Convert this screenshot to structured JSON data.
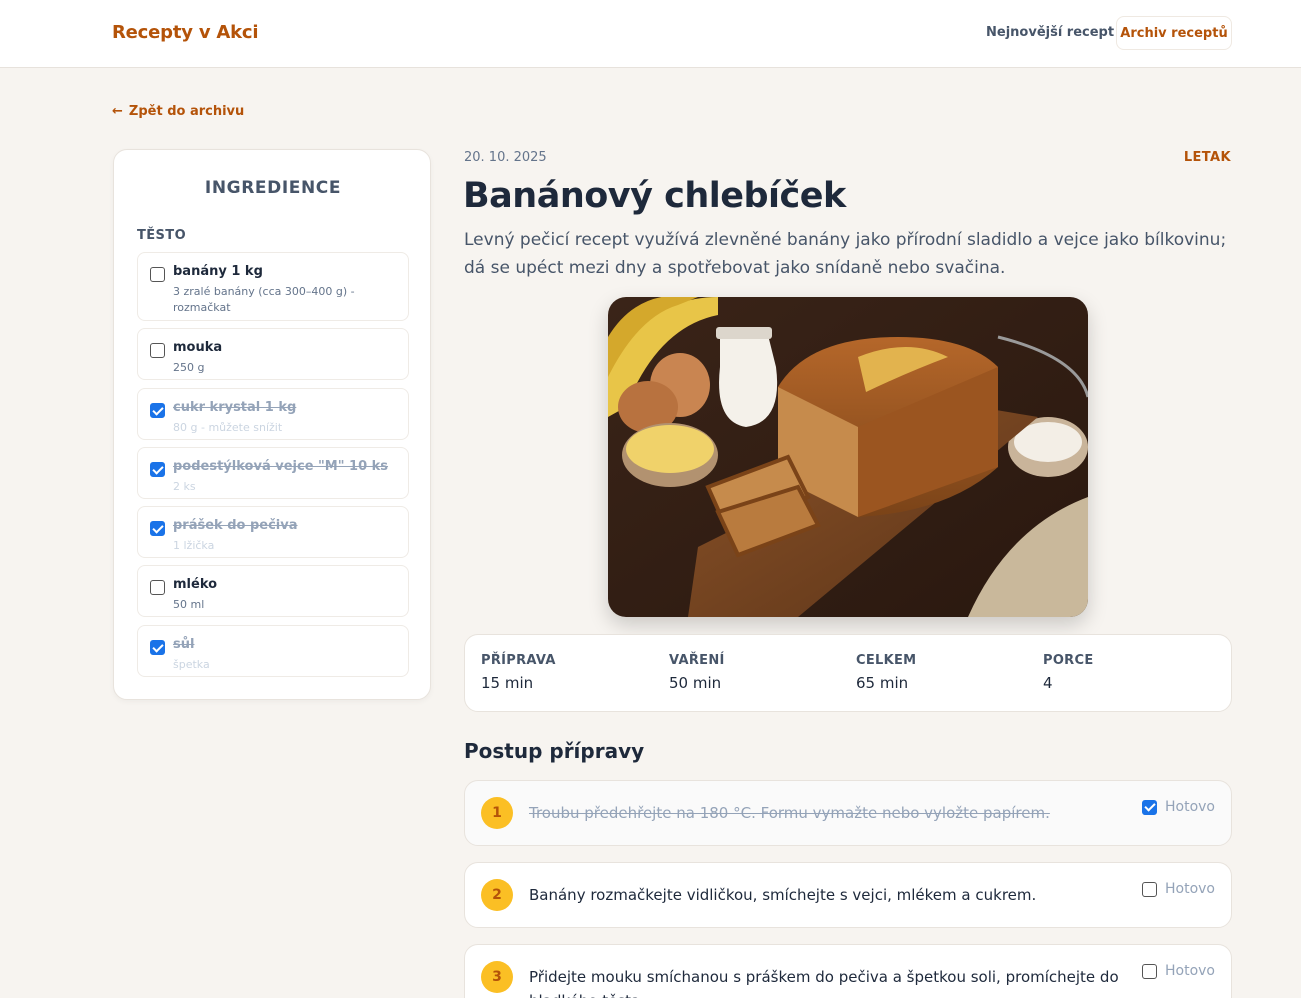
{
  "header": {
    "brand": "Recepty v Akci",
    "nav_latest": "Nejnovější recept",
    "nav_archive": "Archiv receptů"
  },
  "back_link": {
    "arrow": "←",
    "label": "Zpět do archivu"
  },
  "sidebar": {
    "title": "INGREDIENCE",
    "section": "TĚSTO",
    "items": [
      {
        "name": "banány 1 kg",
        "note": "3 zralé banány (cca 300–400 g) - rozmačkat",
        "checked": false
      },
      {
        "name": "mouka",
        "note": "250 g",
        "checked": false
      },
      {
        "name": "cukr krystal 1 kg",
        "note": "80 g - můžete snížit",
        "checked": true
      },
      {
        "name": "podestýlková vejce \"M\" 10 ks",
        "note": "2 ks",
        "checked": true
      },
      {
        "name": "prášek do pečiva",
        "note": "1 lžička",
        "checked": true
      },
      {
        "name": "mléko",
        "note": "50 ml",
        "checked": false
      },
      {
        "name": "sůl",
        "note": "špetka",
        "checked": true
      }
    ]
  },
  "recipe": {
    "date": "20. 10. 2025",
    "tag": "LETAK",
    "title": "Banánový chlebíček",
    "description": "Levný pečicí recept využívá zlevněné banány jako přírodní sladidlo a vejce jako bílkovinu; dá se upéct mezi dny a spotřebovat jako snídaně nebo svačina.",
    "stats": [
      {
        "label": "PŘÍPRAVA",
        "value": "15 min"
      },
      {
        "label": "VAŘENÍ",
        "value": "50 min"
      },
      {
        "label": "CELKEM",
        "value": "65 min"
      },
      {
        "label": "PORCE",
        "value": "4"
      }
    ]
  },
  "steps": {
    "heading": "Postup přípravy",
    "done_label": "Hotovo",
    "items": [
      {
        "number": "1",
        "text": "Troubu předehřejte na 180 °C. Formu vymažte nebo vyložte papírem.",
        "done": true
      },
      {
        "number": "2",
        "text": "Banány rozmačkejte vidličkou, smíchejte s vejci, mlékem a cukrem.",
        "done": false
      },
      {
        "number": "3",
        "text": "Přidejte mouku smíchanou s práškem do pečiva a špetkou soli, promíchejte do hladkého těsta.",
        "done": false
      }
    ]
  }
}
